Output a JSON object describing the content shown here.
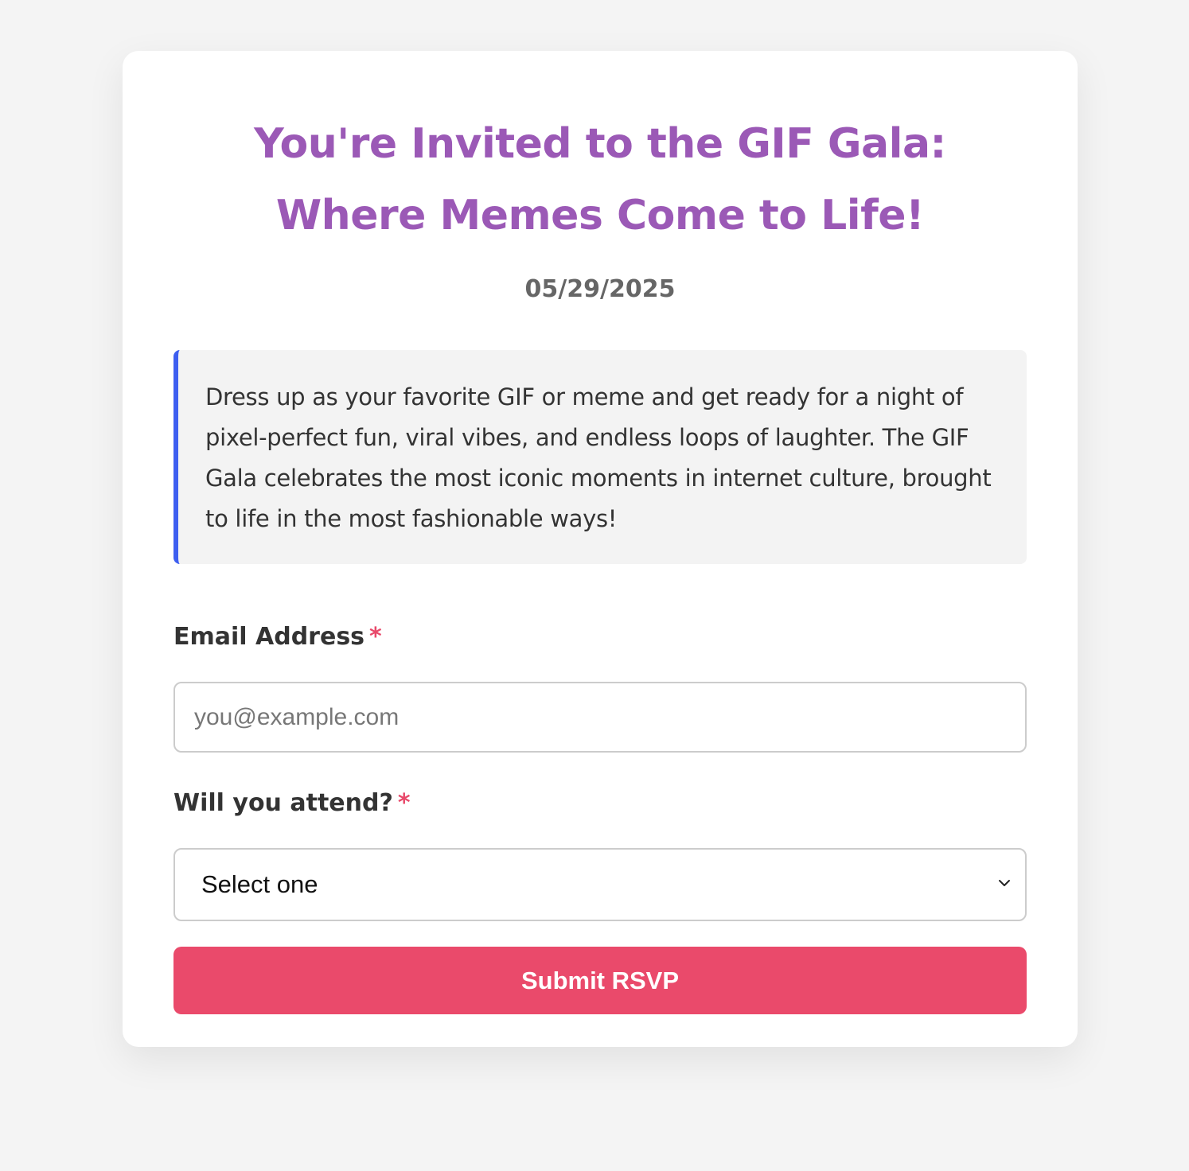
{
  "invitation": {
    "title": "You're Invited to the GIF Gala: Where Memes Come to Life!",
    "date": "05/29/2025",
    "description": "Dress up as your favorite GIF or meme and get ready for a night of pixel-perfect fun, viral vibes, and endless loops of laughter. The GIF Gala celebrates the most iconic moments in internet culture, brought to life in the most fashionable ways!"
  },
  "form": {
    "email": {
      "label": "Email Address",
      "required_marker": "*",
      "value": "",
      "placeholder": "you@example.com"
    },
    "attendance": {
      "label": "Will you attend?",
      "required_marker": "*",
      "selected": "Select one",
      "icon": "chevron-down-icon"
    },
    "submit_label": "Submit RSVP"
  },
  "colors": {
    "page_background": "#f4f4f4",
    "card_background": "#ffffff",
    "title": "#9b59b6",
    "date": "#666666",
    "description_background": "#f3f3f3",
    "description_accent": "#3d5ef0",
    "required": "#e8496a",
    "submit_background": "#ea4a6b"
  }
}
